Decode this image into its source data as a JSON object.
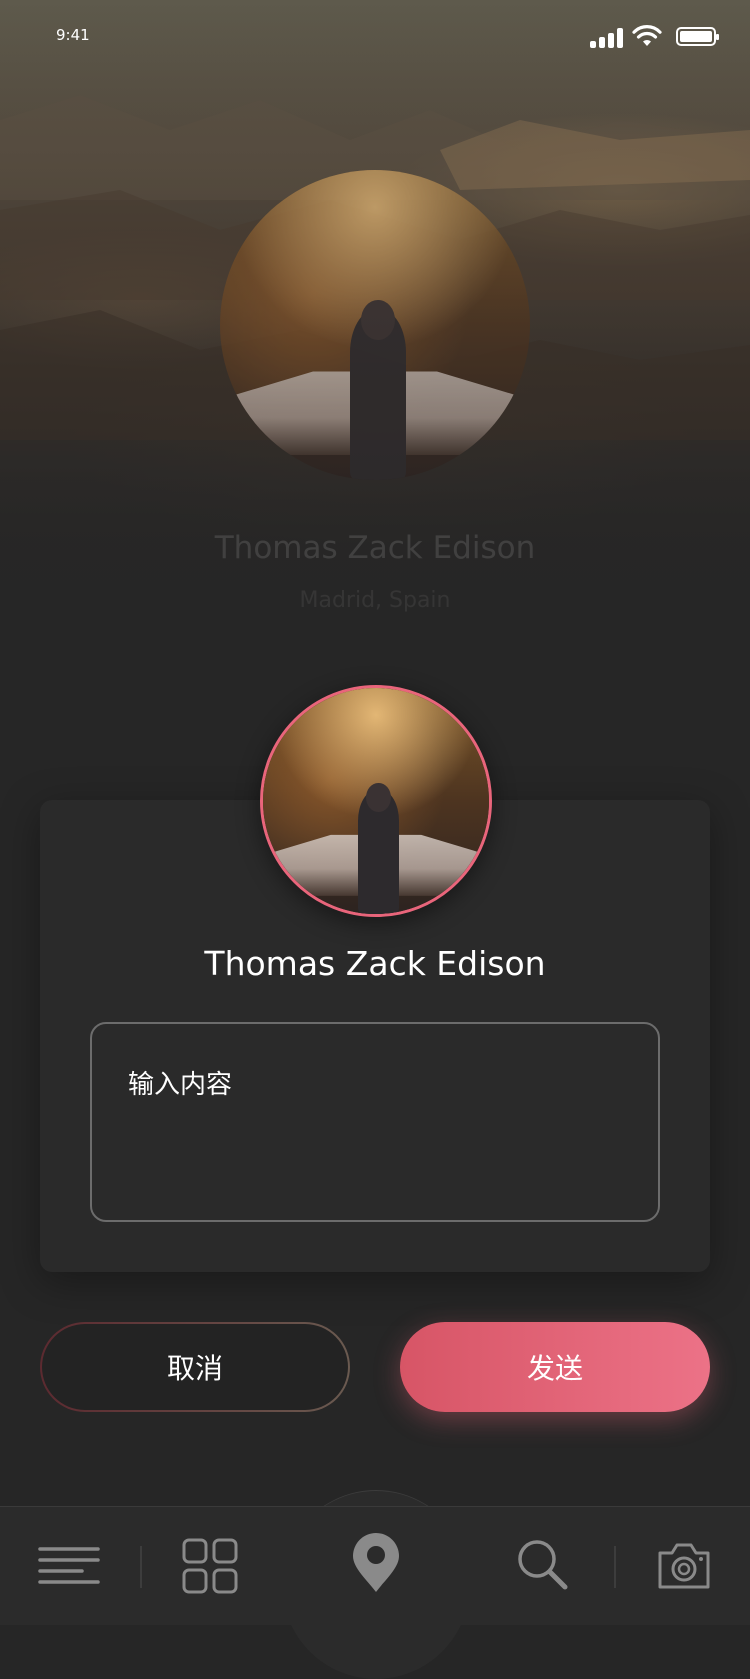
{
  "status_bar": {
    "time": "9:41"
  },
  "profile_background": {
    "name": "Thomas Zack Edison",
    "location": "Madrid, Spain"
  },
  "card": {
    "name": "Thomas Zack Edison",
    "message_placeholder": "输入内容"
  },
  "buttons": {
    "cancel_label": "取消",
    "send_label": "发送"
  },
  "tab_bar": {
    "items": [
      {
        "icon": "menu-icon"
      },
      {
        "icon": "grid-icon"
      },
      {
        "icon": "location-pin-icon"
      },
      {
        "icon": "search-icon"
      },
      {
        "icon": "camera-icon"
      }
    ]
  },
  "colors": {
    "accent": "#e9657b",
    "background": "#262626",
    "card": "#2a2a2a"
  }
}
